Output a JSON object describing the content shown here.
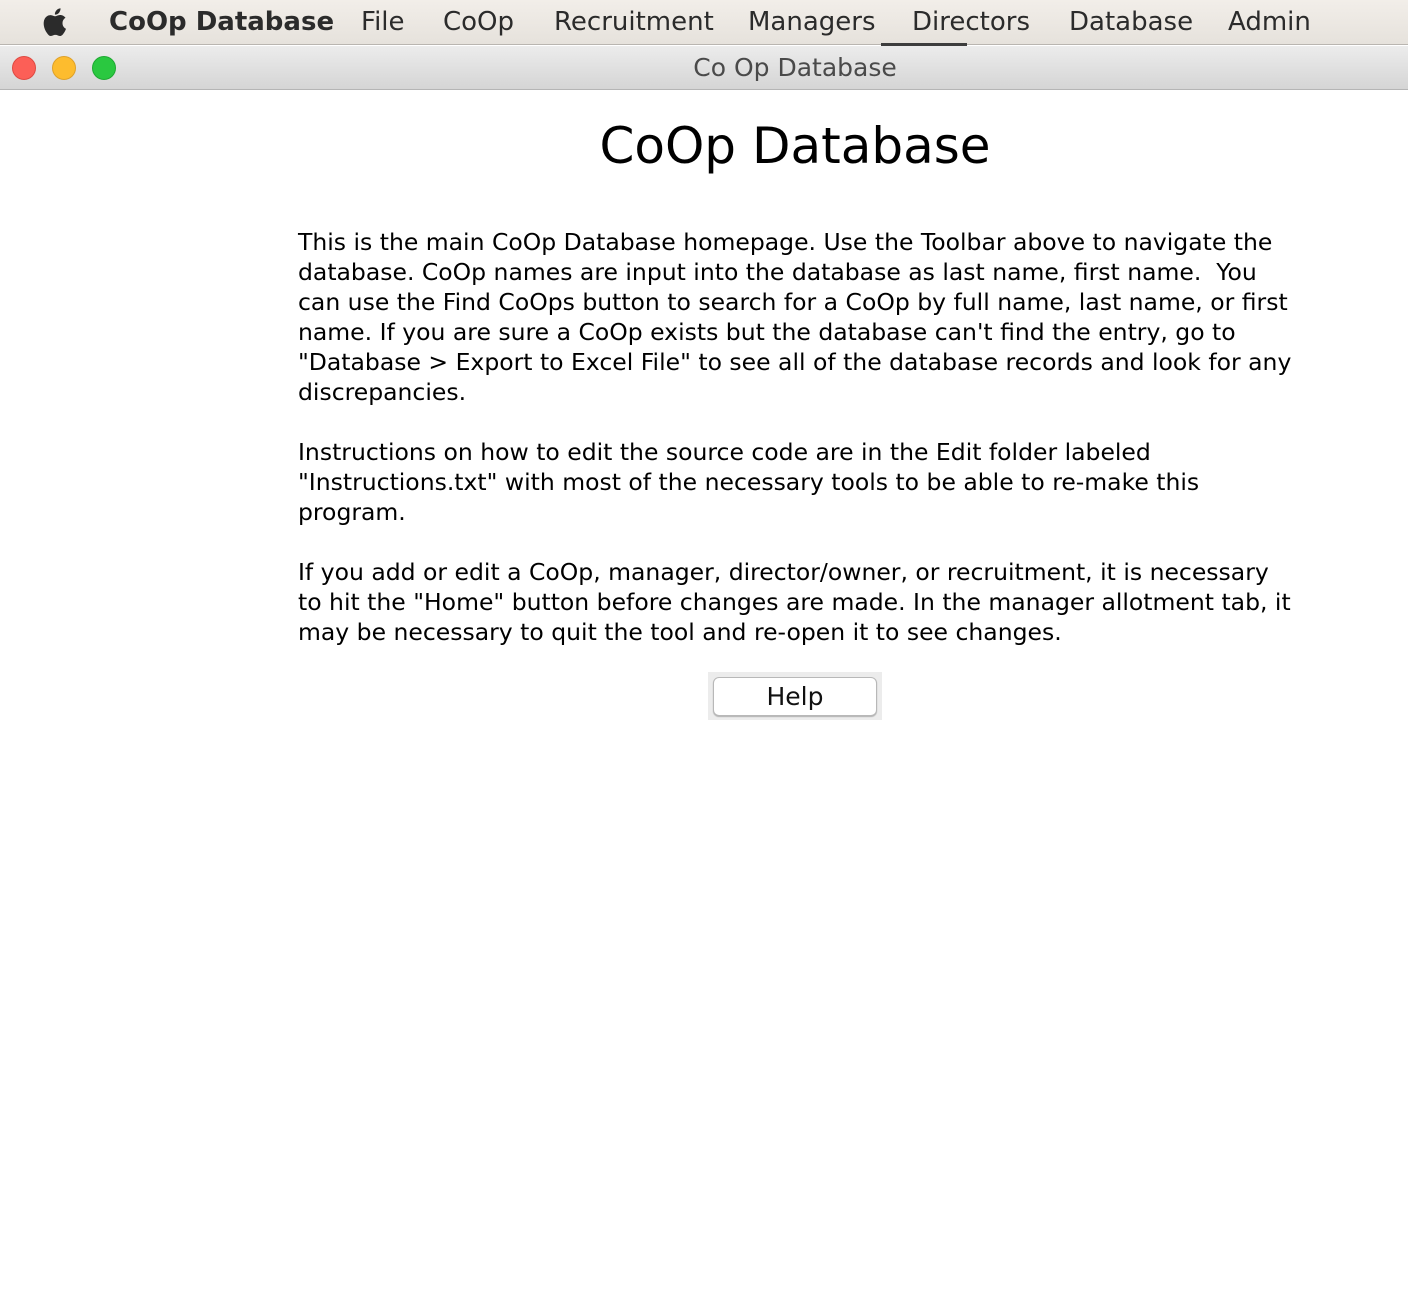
{
  "menubar": {
    "app_name": "CoOp Database",
    "items": [
      {
        "label": "File"
      },
      {
        "label": "CoOp"
      },
      {
        "label": "Recruitment"
      },
      {
        "label": "Managers"
      },
      {
        "label": "Directors"
      },
      {
        "label": "Database"
      },
      {
        "label": "Admin"
      }
    ],
    "apple_icon": "apple-logo-icon"
  },
  "window": {
    "title": "Co Op Database",
    "controls": [
      "close-icon",
      "minimize-icon",
      "maximize-icon"
    ],
    "colors": {
      "close": "#fc5f57",
      "minimize": "#fdbc2e",
      "maximize": "#2ac840"
    }
  },
  "main": {
    "heading": "CoOp Database",
    "paragraphs": [
      "This is the main CoOp Database homepage. Use the Toolbar above to navigate the database. CoOp names are input into the database as last name, first name.  You can use the Find CoOps button to search for a CoOp by full name, last name, or first name. If you are sure a CoOp exists but the database can't find the entry, go to \"Database > Export to Excel File\" to see all of the database records and look for any discrepancies.",
      "Instructions on how to edit the source code are in the Edit folder labeled \"Instructions.txt\" with most of the necessary tools to be able to re-make this program.",
      "If you add or edit a CoOp, manager, director/owner, or recruitment, it is necessary to hit the \"Home\" button before changes are made. In the manager allotment tab, it may be necessary to quit the tool and re-open it to see changes."
    ],
    "help_label": "Help"
  }
}
